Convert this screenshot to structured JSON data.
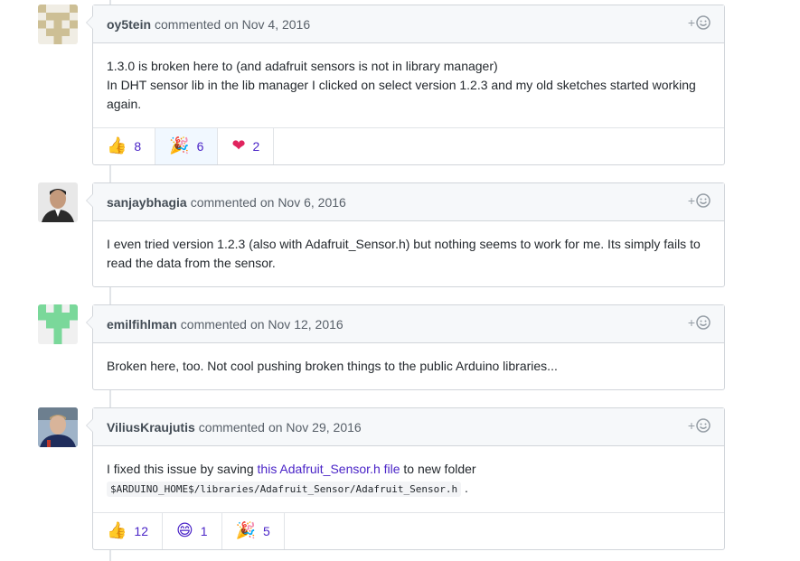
{
  "comments": [
    {
      "author": "oy5tein",
      "commented": "commented",
      "date": "on Nov 4, 2016",
      "body_lines": [
        "1.3.0 is broken here to (and adafruit sensors is not in library manager)",
        "In DHT sensor lib in the lib manager I clicked on select version 1.2.3 and my old sketches started working again."
      ],
      "reactions": [
        {
          "emoji": "👍",
          "icon": "thumbs-up-icon",
          "count": "8"
        },
        {
          "emoji": "🎉",
          "icon": "tada-icon",
          "count": "6"
        },
        {
          "emoji": "❤",
          "icon": "heart-icon",
          "count": "2"
        }
      ]
    },
    {
      "author": "sanjaybhagia",
      "commented": "commented",
      "date": "on Nov 6, 2016",
      "body_lines": [
        "I even tried version 1.2.3 (also with Adafruit_Sensor.h) but nothing seems to work for me. Its simply fails to read the data from the sensor."
      ]
    },
    {
      "author": "emilfihlman",
      "commented": "commented",
      "date": "on Nov 12, 2016",
      "body_lines": [
        "Broken here, too. Not cool pushing broken things to the public Arduino libraries..."
      ]
    },
    {
      "author": "ViliusKraujutis",
      "commented": "commented",
      "date": "on Nov 29, 2016",
      "body_prefix": "I fixed this issue by saving ",
      "body_link": "this Adafruit_Sensor.h file",
      "body_suffix": " to new folder",
      "body_code": "$ARDUINO_HOME$/libraries/Adafruit_Sensor/Adafruit_Sensor.h",
      "body_end": " .",
      "reactions": [
        {
          "emoji": "👍",
          "icon": "thumbs-up-icon",
          "count": "12"
        },
        {
          "emoji": "😄",
          "icon": "smile-icon",
          "count": "1"
        },
        {
          "emoji": "🎉",
          "icon": "tada-icon",
          "count": "5"
        }
      ]
    }
  ],
  "react_plus": "+",
  "colors": {
    "link": "#4a24c7",
    "header_bg": "#f6f8fa",
    "border": "#d1d5da"
  }
}
